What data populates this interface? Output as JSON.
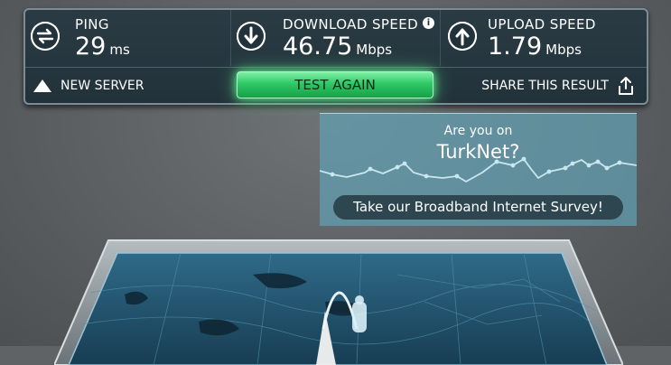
{
  "stats": {
    "ping": {
      "label": "PING",
      "value": "29",
      "unit": "ms",
      "icon": "ping-arrows-icon"
    },
    "download": {
      "label": "DOWNLOAD SPEED",
      "value": "46.75",
      "unit": "Mbps",
      "icon": "download-arrow-icon",
      "info": "i"
    },
    "upload": {
      "label": "UPLOAD SPEED",
      "value": "1.79",
      "unit": "Mbps",
      "icon": "upload-arrow-icon"
    }
  },
  "actions": {
    "new_server": "NEW SERVER",
    "test_again": "TEST AGAIN",
    "share": "SHARE THIS RESULT"
  },
  "survey": {
    "question": "Are you on",
    "isp": "TurkNet?",
    "button": "Take our Broadband Internet Survey!"
  },
  "colors": {
    "panel": "#22323a",
    "accent_green": "#2fc866",
    "survey_bg": "#63a0b2",
    "map_blue": "#1c4e6a"
  }
}
